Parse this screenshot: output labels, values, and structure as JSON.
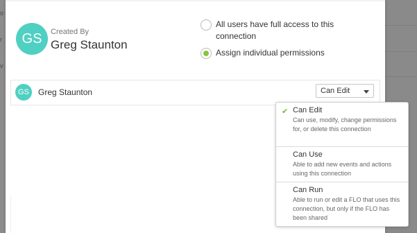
{
  "backdrop": {
    "fragments": [
      "o",
      "r",
      "v"
    ]
  },
  "creator": {
    "initials": "GS",
    "label": "Created By",
    "name": "Greg Staunton"
  },
  "access": {
    "option_all": "All users have full access to this connection",
    "option_individual": "Assign individual permissions",
    "selected": "Assign individual permissions"
  },
  "user_row": {
    "initials": "GS",
    "name": "Greg Staunton",
    "permission": "Can Edit"
  },
  "dropdown": {
    "options": [
      {
        "title": "Can Edit",
        "description": "Can use, modify, change permissions for, or delete this connection",
        "selected": true
      },
      {
        "title": "Can Use",
        "description": "Able to add new events and actions using this connection",
        "selected": false
      },
      {
        "title": "Can Run",
        "description": "Able to run or edit a FLO that uses this connection, but only if the FLO has been shared",
        "selected": false
      }
    ]
  },
  "colors": {
    "avatar": "#4fd0c2",
    "radio_selected": "#8ac43f",
    "check": "#7cb735"
  },
  "icons": {
    "selected_option": "checkmark-icon",
    "select_caret": "caret-down-icon"
  }
}
